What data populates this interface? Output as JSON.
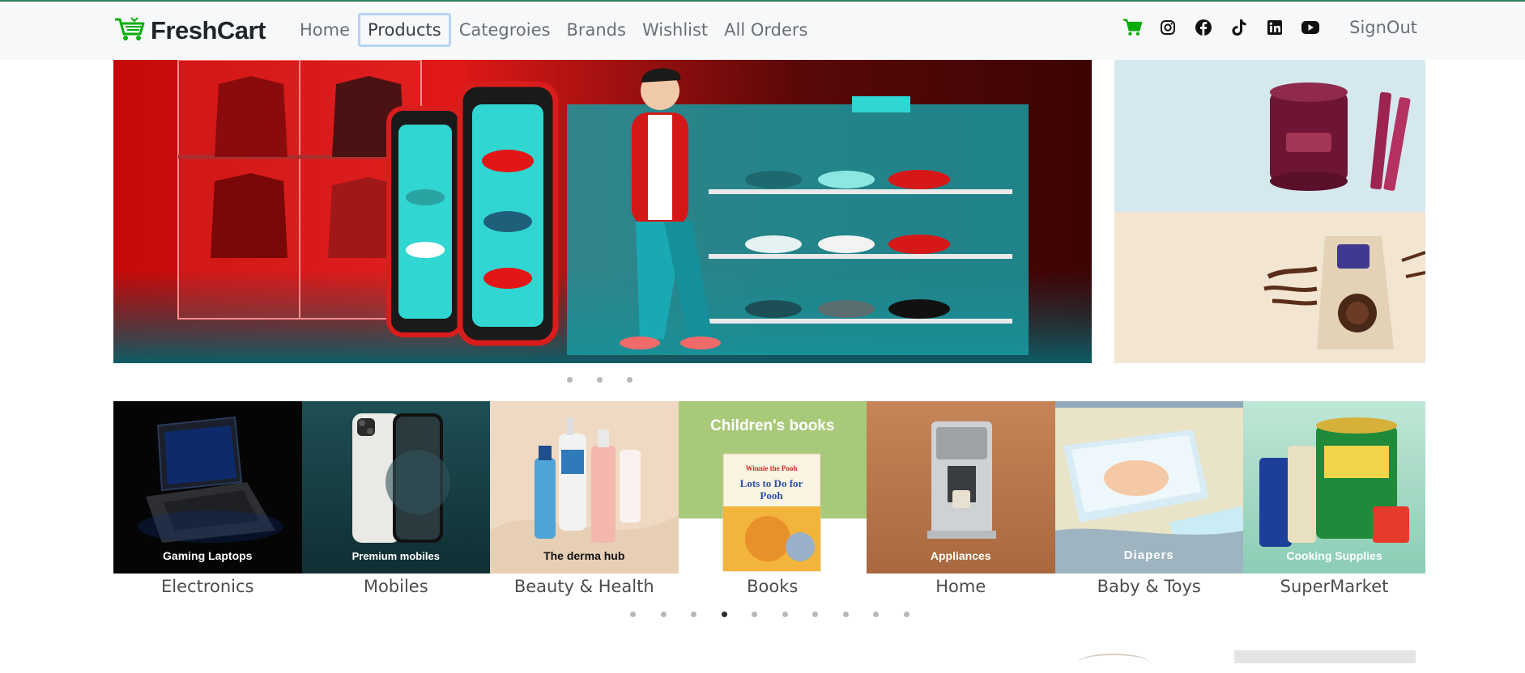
{
  "brand": {
    "name": "FreshCart"
  },
  "nav": {
    "links": [
      "Home",
      "Products",
      "Categroies",
      "Brands",
      "Wishlist",
      "All Orders"
    ],
    "active": "Products"
  },
  "header_right": {
    "icons": [
      "cart-icon",
      "instagram-icon",
      "facebook-icon",
      "tiktok-icon",
      "linkedin-icon",
      "youtube-icon"
    ],
    "signout": "SignOut"
  },
  "colors": {
    "accent": "#0aad0a",
    "navbar_bg": "#f7f8f9",
    "active_outline": "#b7d3f5"
  },
  "main_slider": {
    "dots": 3,
    "active_dot": -1
  },
  "categories": {
    "items": [
      {
        "name": "Electronics",
        "caption": "Gaming Laptops"
      },
      {
        "name": "Mobiles",
        "caption": "Premium mobiles"
      },
      {
        "name": "Beauty & Health",
        "caption": "The derma hub"
      },
      {
        "name": "Books",
        "caption": "Children's books",
        "book_title": "Lots to Do for Pooh",
        "book_brand": "Winnie the Pooh"
      },
      {
        "name": "Home",
        "caption": "Appliances"
      },
      {
        "name": "Baby & Toys",
        "caption": "Diapers"
      },
      {
        "name": "SuperMarket",
        "caption": "Cooking Supplies"
      }
    ],
    "dots": 10,
    "active_dot": 3
  }
}
